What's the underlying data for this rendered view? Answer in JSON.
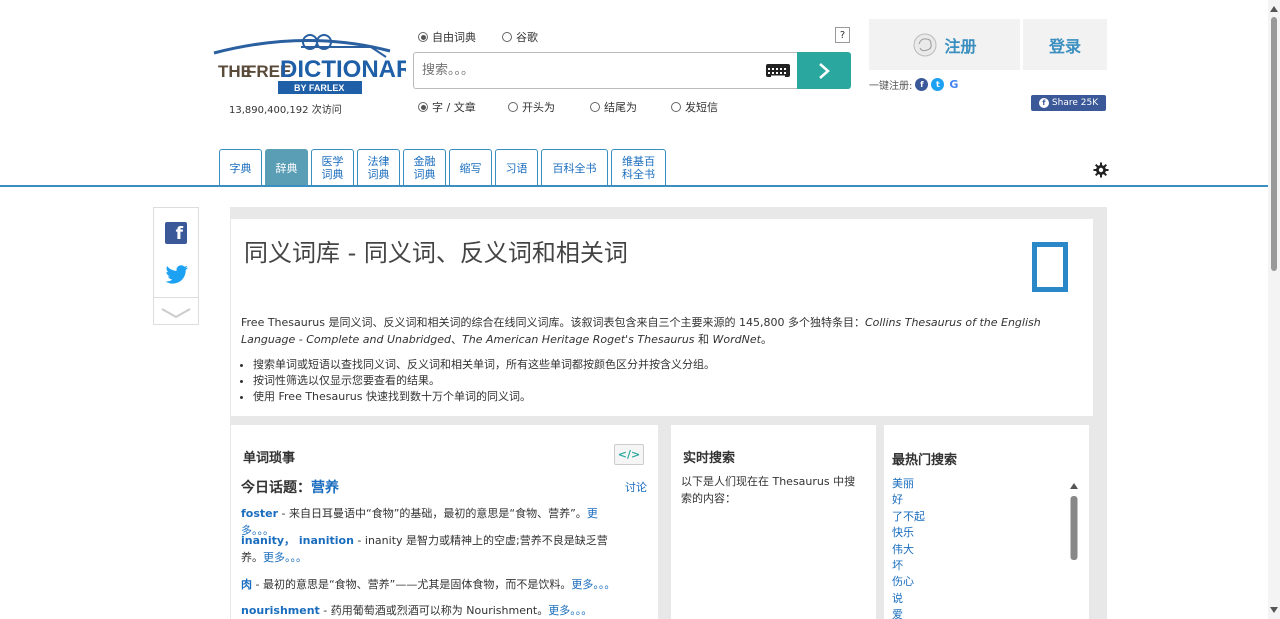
{
  "header": {
    "logo": {
      "the": "THE",
      "free": "FREE",
      "dictionary": "DICTIONARY",
      "by": "BY FARLEX"
    },
    "visits": "13,890,400,192 次访问",
    "source_options": [
      {
        "label": "自由词典",
        "selected": true
      },
      {
        "label": "谷歌",
        "selected": false
      }
    ],
    "search": {
      "placeholder": "搜索。。。",
      "help": "?"
    },
    "mode_options": [
      {
        "label": "字 / 文章",
        "selected": true
      },
      {
        "label": "开头为",
        "selected": false
      },
      {
        "label": "结尾为",
        "selected": false
      },
      {
        "label": "发短信",
        "selected": false
      }
    ],
    "register": "注册",
    "login": "登录",
    "quick_register": "一键注册:",
    "share": "Share 25K"
  },
  "tabs": [
    {
      "label": "字典",
      "active": false
    },
    {
      "label": "辞典",
      "active": true
    },
    {
      "label": "医学词典",
      "active": false
    },
    {
      "label": "法律词典",
      "active": false
    },
    {
      "label": "金融词典",
      "active": false
    },
    {
      "label": "缩写",
      "active": false
    },
    {
      "label": "习语",
      "active": false
    },
    {
      "label": "百科全书",
      "active": false
    },
    {
      "label": "维基百科全书",
      "active": false
    }
  ],
  "intro": {
    "title": "同义词库 - 同义词、反义词和相关词",
    "desc_pre": "Free Thesaurus 是同义词、反义词和相关词的综合在线同义词库。该叙词表包含来自三个主要来源的 145,800 多个独特条目：",
    "src1": "Collins Thesaurus of the English Language - Complete and Unabridged",
    "sep1": "、",
    "src2": "The American Heritage Roget's Thesaurus",
    "sep2": " 和 ",
    "src3": "WordNet",
    "end": "。",
    "bullets": [
      "搜索单词或短语以查找同义词、反义词和相关单词，所有这些单词都按颜色区分并按含义分组。",
      "按词性筛选以仅显示您要查看的结果。",
      "使用 Free Thesaurus 快速找到数十万个单词的同义词。"
    ]
  },
  "trivia": {
    "title": "单词琐事",
    "embed": "</>",
    "topic_label": "今日话题：",
    "topic": "营养",
    "discuss": "讨论",
    "more": "更多。。。",
    "entries": [
      {
        "word": "foster",
        "text": " - 来自日耳曼语中“食物”的基础，最初的意思是“食物、营养”。"
      },
      {
        "word": "inanity， inanition",
        "text": " - inanity 是智力或精神上的空虚;营养不良是缺乏营养。"
      },
      {
        "word": "肉",
        "text": " - 最初的意思是“食物、营养”——尤其是固体食物，而不是饮料。"
      },
      {
        "word": "nourishment",
        "text": " - 药用葡萄酒或烈酒可以称为 Nourishment。"
      }
    ]
  },
  "live": {
    "title": "实时搜索",
    "text": "以下是人们现在在 Thesaurus 中搜索的内容："
  },
  "popular": {
    "title": "最热门搜索",
    "items": [
      "美丽",
      "好",
      "了不起",
      "快乐",
      "伟大",
      "坏",
      "伤心",
      "说",
      "爱"
    ]
  },
  "colors": {
    "accent": "#3a8fc0",
    "teal": "#2aa8a0",
    "link": "#1a6dbe",
    "facebook": "#3b5998",
    "twitter": "#1da1f2"
  }
}
